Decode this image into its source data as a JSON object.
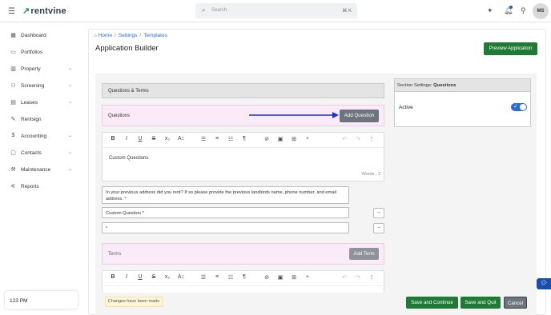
{
  "header": {
    "brand": "rentvine",
    "search_placeholder": "Search",
    "search_shortcut": "⌘ K",
    "avatar_initials": "MS"
  },
  "sidebar": {
    "items": [
      {
        "label": "Dashboard",
        "icon": "dashboard-icon",
        "expandable": false
      },
      {
        "label": "Portfolios",
        "icon": "folder-icon",
        "expandable": false
      },
      {
        "label": "Property",
        "icon": "building-icon",
        "expandable": true
      },
      {
        "label": "Screening",
        "icon": "screening-icon",
        "expandable": true
      },
      {
        "label": "Leases",
        "icon": "lease-icon",
        "expandable": true
      },
      {
        "label": "Rentsign",
        "icon": "signature-icon",
        "expandable": false
      },
      {
        "label": "Accounting",
        "icon": "dollar-icon",
        "expandable": true
      },
      {
        "label": "Contacts",
        "icon": "contacts-icon",
        "expandable": true
      },
      {
        "label": "Maintenance",
        "icon": "wrench-icon",
        "expandable": true
      },
      {
        "label": "Reports",
        "icon": "chart-icon",
        "expandable": false
      }
    ],
    "time": "123 PM"
  },
  "breadcrumb": [
    "Home",
    "Settings",
    "Templates"
  ],
  "page": {
    "title": "Application Builder",
    "preview_button": "Preview Application"
  },
  "builder": {
    "section_title": "Questions & Terms",
    "questions_label": "Questions",
    "add_question": "Add Question",
    "editor1_text": "Custom Questions",
    "editor1_words": "Words : 2",
    "question_prompt": "In your previous address did you rent? If so please provide the previous landlords name, phone number, and email address.",
    "required_mark": "*",
    "custom_question_value": "Custom Question",
    "remove_label": "–",
    "terms_label": "Terms",
    "add_term": "Add Term"
  },
  "settings_panel": {
    "heading_prefix": "Section Settings:",
    "heading_section": "Questions",
    "active_label": "Active",
    "active": true
  },
  "footer": {
    "changes_notice": "Changes have been made",
    "save_continue": "Save and Continue",
    "save_quit": "Save and Quit",
    "cancel": "Cancel"
  },
  "colors": {
    "primary_green": "#1f7a35",
    "link_blue": "#2a6bd6",
    "pink_section": "#fbeaf7",
    "gray_button": "#6c757d"
  }
}
